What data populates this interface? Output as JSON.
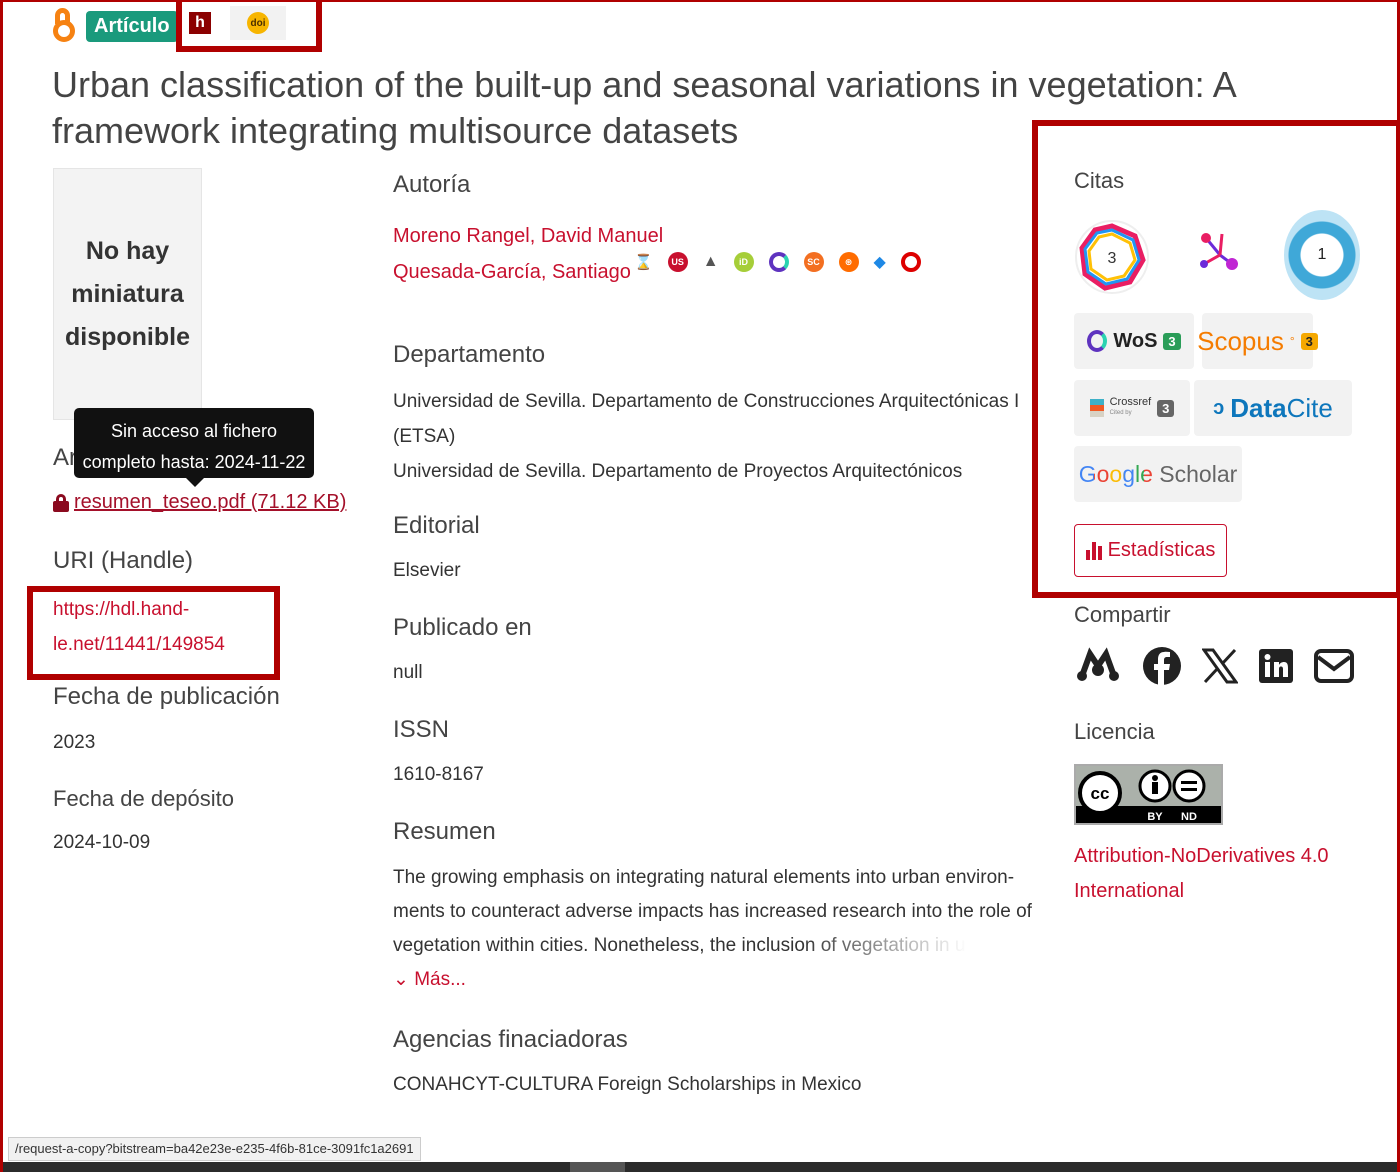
{
  "header": {
    "type_badge": "Artículo",
    "title": "Urban classification of the built-up and seasonal variations in vegetation: A framework integrating multisource datasets"
  },
  "left": {
    "thumbnail_text": "No hay miniatura disponible",
    "tooltip_line1": "Sin acceso al fichero",
    "tooltip_line2": "completo hasta: 2024-11-22",
    "archivos_peek": "Ar",
    "file_link": "resumen_teseo.pdf (71.12 KB)",
    "uri_label": "URI (Handle)",
    "uri_line1": "https://hdl.hand-",
    "uri_line2": "le.net/11441/149854",
    "pubdate_label": "Fecha de publicación",
    "pubdate": "2023",
    "depdate_label": "Fecha de depósito",
    "depdate": "2024-10-09"
  },
  "middle": {
    "authors_label": "Autoría",
    "authors": [
      "Moreno Rangel, David Manuel",
      "Quesada-García, Santiago"
    ],
    "author_icons": [
      "hourglass-icon",
      "us-icon",
      "mountain-icon",
      "orcid-icon",
      "wos-icon",
      "scholar-sc-icon",
      "scopus-icon",
      "tag-icon",
      "dialnet-icon"
    ],
    "dept_label": "Departamento",
    "dept_1a": "Universidad de Sevilla. Departamento de Construcciones Arquitectónicas I",
    "dept_1b": "(ETSA)",
    "dept_2": "Universidad de Sevilla. Departamento de Proyectos Arquitectónicos",
    "editorial_label": "Editorial",
    "editorial": "Elsevier",
    "publicado_label": "Publicado en",
    "publicado": "null",
    "issn_label": "ISSN",
    "issn": "1610-8167",
    "resumen_label": "Resumen",
    "abstract_l1": "The growing emphasis on integrating natural elements into urban environ-",
    "abstract_l2": "ments to counteract adverse impacts has increased research into the role of",
    "abstract_l3": "vegetation within cities. Nonetheless, the inclusion of vegetation in u",
    "more": "Más...",
    "funding_label": "Agencias finaciadoras",
    "funding": "CONAHCYT-CULTURA Foreign Scholarships in Mexico"
  },
  "right": {
    "citas_label": "Citas",
    "altmetric_count": "3",
    "dimensions_count": "1",
    "wos_label": "WoS",
    "wos_count": "3",
    "scopus_label": "Scopus",
    "scopus_sup": "°",
    "scopus_count": "3",
    "crossref_label": "Crossref",
    "crossref_sub": "Cited by",
    "crossref_count": "3",
    "datacite_a": "Data",
    "datacite_b": "Cite",
    "google_a": "Google",
    "google_b": " Scholar",
    "stats_button": "Estadísticas",
    "share_label": "Compartir",
    "license_label": "Licencia",
    "cc_by": "BY",
    "cc_nd": "ND",
    "license_l1": "Attribution-NoDerivatives 4.0",
    "license_l2": "International"
  },
  "statusbar": "/request-a-copy?bitstream=ba42e23e-e235-4f6b-81ce-3091fc1a2691",
  "colors": {
    "accent": "#c8102e",
    "highlight": "#b00000",
    "badge": "#1a9a7c"
  }
}
